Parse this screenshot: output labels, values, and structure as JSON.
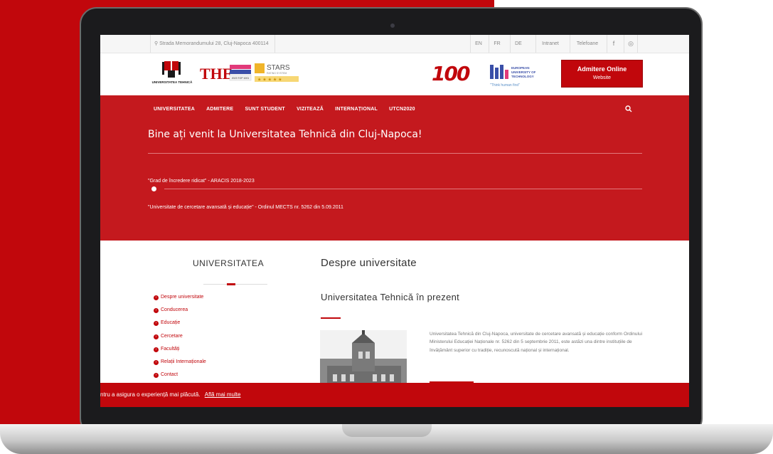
{
  "topbar": {
    "address": "Strada Memorandumului 28, Cluj-Napoca 400114",
    "links": [
      "EN",
      "FR",
      "DE",
      "Intranet",
      "Telefoane"
    ],
    "social_facebook": "f",
    "social_instagram": "◎"
  },
  "header": {
    "logo_utcn": "UNIVERSITATEA TEHNICĂ",
    "logo_the": "THE",
    "logo_the_sub": "2023 TOP 1001",
    "logo_stars": "STARS",
    "logo_stars_sub": "RATING SYSTEM",
    "logo_100": "100",
    "logo_eut_lines": [
      "EUROPEAN",
      "UNIVERSITY OF",
      "TECHNOLOGY"
    ],
    "logo_eut_slogan": "\"Think human first\"",
    "admitere_title": "Admitere Online",
    "admitere_sub": "Website"
  },
  "nav": {
    "items": [
      "UNIVERSITATEA",
      "ADMITERE",
      "SUNT STUDENT",
      "VIZITEAZĂ",
      "INTERNAȚIONAL",
      "UTCN2020"
    ]
  },
  "hero": {
    "welcome": "Bine ați venit la Universitatea Tehnică din Cluj-Napoca!",
    "quote1": "\"Grad de încredere ridicat\" - ARACIS 2018-2023",
    "quote2": "\"Universitate de cercetare avansată și educație\" - Ordinul MECTS nr. 5262 din 5.09.2011"
  },
  "sidebar": {
    "title": "UNIVERSITATEA",
    "items": [
      "Despre universitate",
      "Conducerea",
      "Educație",
      "Cercetare",
      "Facultăți",
      "Relații Internaționale",
      "Contact"
    ]
  },
  "main": {
    "title": "Despre universitate",
    "subtitle": "Universitatea Tehnică în prezent",
    "paragraph": "Universitatea Tehnică din Cluj-Napoca, universitate de cercetare avansată și educație conform Ordinului Ministerului Educației Naționale nr. 5262 din 5 septembrie 2011, este astăzi una dintre instituțiile de învățământ superior cu tradiție, recunoscută național și internațional."
  },
  "cookie": {
    "text": "ntru a asigura o experiență mai plăcută.",
    "link": "Află mai multe"
  },
  "colors": {
    "brand_red": "#c1070c",
    "hero_red": "#c4191e"
  }
}
